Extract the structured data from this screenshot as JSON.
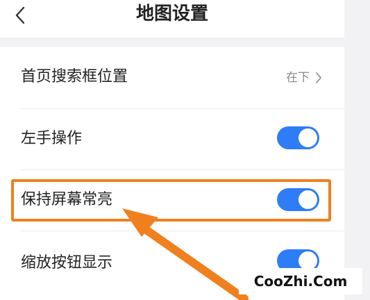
{
  "header": {
    "title": "地图设置"
  },
  "settings": {
    "search_box_position": {
      "label": "首页搜索框位置",
      "value": "在下"
    },
    "left_hand_mode": {
      "label": "左手操作",
      "enabled": true
    },
    "keep_screen_on": {
      "label": "保持屏幕常亮",
      "enabled": true
    },
    "zoom_buttons": {
      "label": "缩放按钮显示",
      "enabled": true
    }
  },
  "annotation": {
    "highlight_color": "#f07f1e"
  },
  "colors": {
    "toggle_on": "#2f7df6",
    "background": "#f2f2f4"
  },
  "icons": {
    "back": "back-icon",
    "chevron": "chevron-right-icon"
  },
  "watermark": {
    "text": "CooZhi.Com"
  }
}
